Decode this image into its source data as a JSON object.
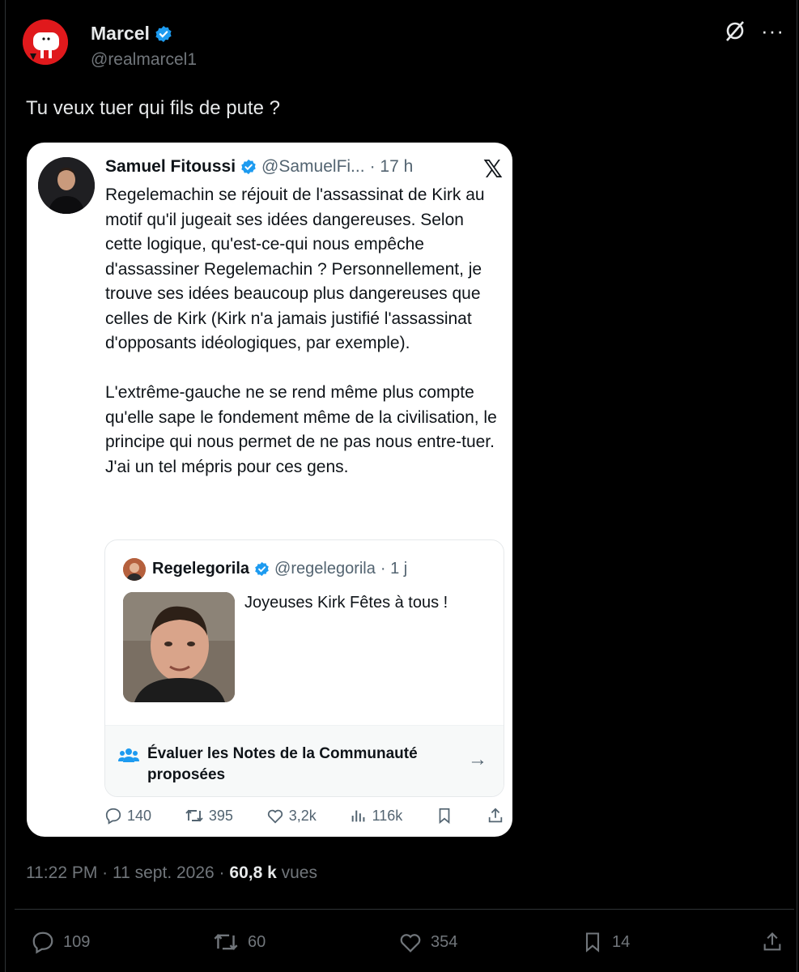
{
  "post": {
    "author_name": "Marcel",
    "author_handle": "@realmarcel1",
    "text": "Tu veux tuer qui fils de pute ?",
    "timestamp": "11:22 PM · 11 sept. 2026",
    "separator": "·",
    "views_count": "60,8 k",
    "views_label": "vues",
    "replies": "109",
    "reposts": "60",
    "likes": "354",
    "bookmarks": "14"
  },
  "quoted": {
    "author_name": "Samuel Fitoussi",
    "author_handle": "@SamuelFi...",
    "time": "· 17 h",
    "x_logo": "𝕏",
    "paragraphs": [
      "Regelemachin se réjouit de l'assassinat de Kirk au motif qu'il jugeait ses idées dangereuses. Selon cette logique, qu'est-ce-qui nous empêche d'assassiner Regelemachin ? Personnellement, je trouve ses idées beaucoup plus dangereuses que celles de Kirk (Kirk n'a jamais justifié l'assassinat d'opposants idéologiques, par exemple).",
      "L'extrême-gauche ne se rend même plus compte qu'elle sape le fondement même de la civilisation, le principe qui nous permet de ne pas nous entre-tuer. J'ai un tel mépris pour ces gens."
    ],
    "replies": "140",
    "reposts": "395",
    "likes": "3,2k",
    "views": "116k"
  },
  "nested": {
    "author_name": "Regelegorila",
    "author_handle": "@regelegorila",
    "time": "· 1 j",
    "text": "Joyeuses Kirk Fêtes à tous !",
    "notes_label": "Évaluer les Notes de la Communauté proposées",
    "notes_arrow": "→"
  },
  "colors": {
    "background": "#000000",
    "verified": "#1d9bf0",
    "muted": "#71767b",
    "card": "#ffffff"
  }
}
